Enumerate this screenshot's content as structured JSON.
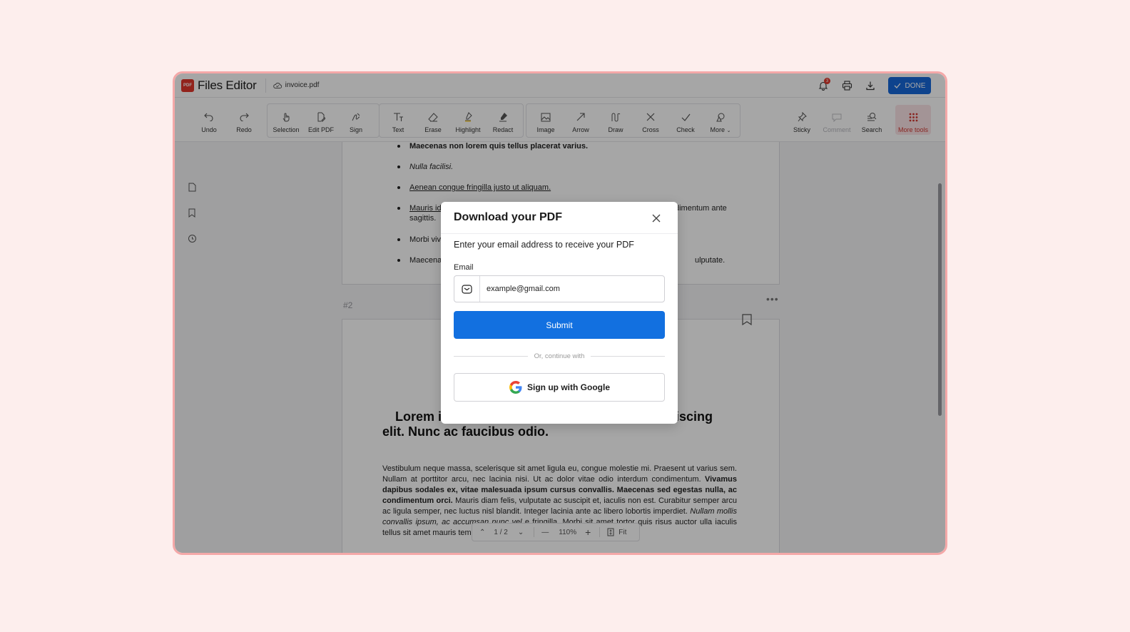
{
  "app": {
    "logo_badge": "PDF",
    "title": "Files Editor",
    "file_name": "invoice.pdf",
    "notification_count": "3",
    "done_label": "DONE"
  },
  "toolbar": {
    "undo": "Undo",
    "redo": "Redo",
    "selection": "Selection",
    "edit_pdf": "Edit PDF",
    "sign": "Sign",
    "text": "Text",
    "erase": "Erase",
    "highlight": "Highlight",
    "redact": "Redact",
    "image": "Image",
    "arrow": "Arrow",
    "draw": "Draw",
    "cross": "Cross",
    "check": "Check",
    "more": "More",
    "sticky": "Sticky",
    "comment": "Comment",
    "search": "Search",
    "more_tools": "More tools"
  },
  "document": {
    "bullets": [
      "Maecenas non lorem quis tellus placerat varius.",
      "Nulla facilisi.",
      "Aenean congue fringilla justo ut aliquam.",
      "Mauris id",
      "dimentum ante",
      "sagittis.",
      "Morbi viv",
      "Maecena",
      "ulputate."
    ],
    "page_label": "#2",
    "heading_left": "Lorem i",
    "heading_right": "piscing",
    "heading_line2": "elit. Nunc ac faucibus odio.",
    "body_1": "Vestibulum neque massa, scelerisque sit amet ligula eu, congue molestie mi. Praesent ut varius sem. Nullam at porttitor arcu, nec lacinia nisi. Ut ac dolor vitae odio interdum condimentum.",
    "body_bold": "Vivamus dapibus sodales ex, vitae malesuada ipsum cursus convallis. Maecenas sed egestas nulla, ac condimentum orci.",
    "body_2": "Mauris diam felis, vulputate ac suscipit et, iaculis non est. Curabitur semper arcu ac ligula semper, nec luctus nisl blandit. Integer lacinia ante ac libero lobortis imperdiet.",
    "body_italic": "Nullam mollis convallis ipsum, ac accumsan nunc vel",
    "body_3": "e fringilla. Morbi sit amet tortor quis risus auctor",
    "body_4": "ulla iaculis tellus sit amet mauris tempus fringilla."
  },
  "pager": {
    "page_display": "1 / 2",
    "zoom": "110%",
    "fit": "Fit"
  },
  "modal": {
    "title": "Download your PDF",
    "subtitle": "Enter your email address to receive your PDF",
    "email_label": "Email",
    "email_placeholder": "example@gmail.com",
    "submit_label": "Submit",
    "divider_text": "Or, continue with",
    "google_label": "Sign up with Google"
  },
  "colors": {
    "accent": "#1270e0",
    "done_button": "#1667d9",
    "logo_red": "#e0362c",
    "frame_border": "#f4a8a8",
    "page_background": "#fdeeed"
  }
}
